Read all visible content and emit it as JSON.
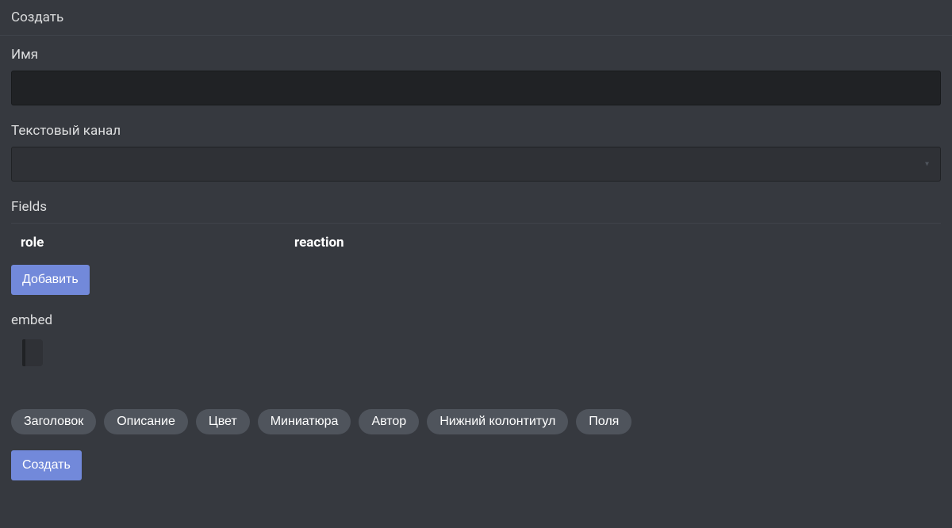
{
  "header": {
    "title": "Создать"
  },
  "form": {
    "name_label": "Имя",
    "name_value": "",
    "channel_label": "Текстовый канал",
    "channel_value": ""
  },
  "fields": {
    "label": "Fields",
    "columns": {
      "role": "role",
      "reaction": "reaction"
    },
    "add_button": "Добавить"
  },
  "embed": {
    "label": "embed"
  },
  "pills": [
    "Заголовок",
    "Описание",
    "Цвет",
    "Миниатюра",
    "Автор",
    "Нижний колонтитул",
    "Поля"
  ],
  "footer": {
    "create_button": "Создать"
  }
}
